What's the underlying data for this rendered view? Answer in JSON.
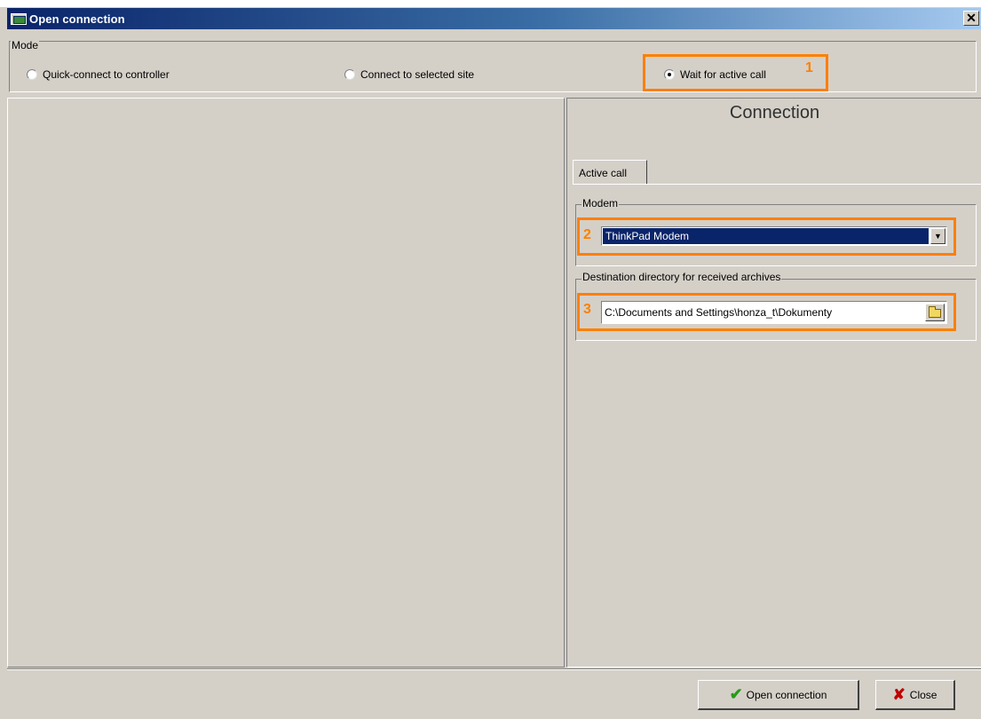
{
  "window": {
    "title": "Open connection",
    "close_glyph": "✕"
  },
  "mode": {
    "legend": "Mode",
    "options": [
      {
        "label": "Quick-connect to controller",
        "checked": false
      },
      {
        "label": "Connect to selected site",
        "checked": false
      },
      {
        "label": "Wait for active call",
        "checked": true
      }
    ]
  },
  "callouts": [
    "1",
    "2",
    "3"
  ],
  "connection": {
    "heading": "Connection",
    "tab_label": "Active call",
    "modem_legend": "Modem",
    "modem_value": "ThinkPad Modem",
    "dest_legend": "Destination directory for received archives",
    "dest_value": "C:\\Documents and Settings\\honza_t\\Dokumenty"
  },
  "buttons": {
    "open_label": "Open connection",
    "close_label": "Close"
  },
  "colors": {
    "highlight": "#ff7f00",
    "titlebar": "#0a246a",
    "dialog_bg": "#d4d0c8"
  },
  "icons": {
    "open": "check-icon",
    "close": "x-icon",
    "browse": "folder-icon",
    "dropdown": "chevron-down-icon"
  }
}
